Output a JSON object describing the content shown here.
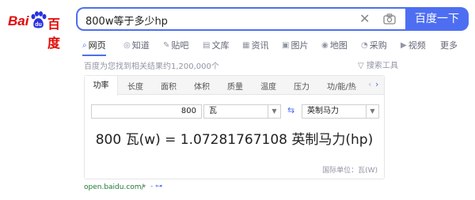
{
  "logo": {
    "bai": "Bai",
    "du": "du",
    "cn": "百度"
  },
  "search": {
    "query": "800w等于多少hp",
    "button": "百度一下"
  },
  "nav": [
    {
      "icon": "⌕",
      "label": "网页"
    },
    {
      "icon": "◎",
      "label": "知道"
    },
    {
      "icon": "✎",
      "label": "贴吧"
    },
    {
      "icon": "▤",
      "label": "文库"
    },
    {
      "icon": "▦",
      "label": "资讯"
    },
    {
      "icon": "▣",
      "label": "图片"
    },
    {
      "icon": "◉",
      "label": "地图"
    },
    {
      "icon": "◔",
      "label": "采购"
    },
    {
      "icon": "▶",
      "label": "视频"
    },
    {
      "icon": "",
      "label": "更多"
    }
  ],
  "results_count": "百度为您找到相关结果约1,200,000个",
  "search_tools": "搜索工具",
  "converter": {
    "tabs": [
      "功率",
      "长度",
      "面积",
      "体积",
      "质量",
      "温度",
      "压力",
      "功/能/热"
    ],
    "value": "800",
    "from_unit": "瓦",
    "to_unit": "英制马力",
    "result": "800 瓦(w) = 1.07281767108 英制马力(hp)",
    "unit_note": "国际单位：瓦(W)"
  },
  "source": {
    "url": "open.baidu.com/",
    "extra": "- ⊶"
  },
  "colors": {
    "accent": "#4e6ef2",
    "logo_red": "#e10602",
    "source_green": "#1e7a34"
  }
}
